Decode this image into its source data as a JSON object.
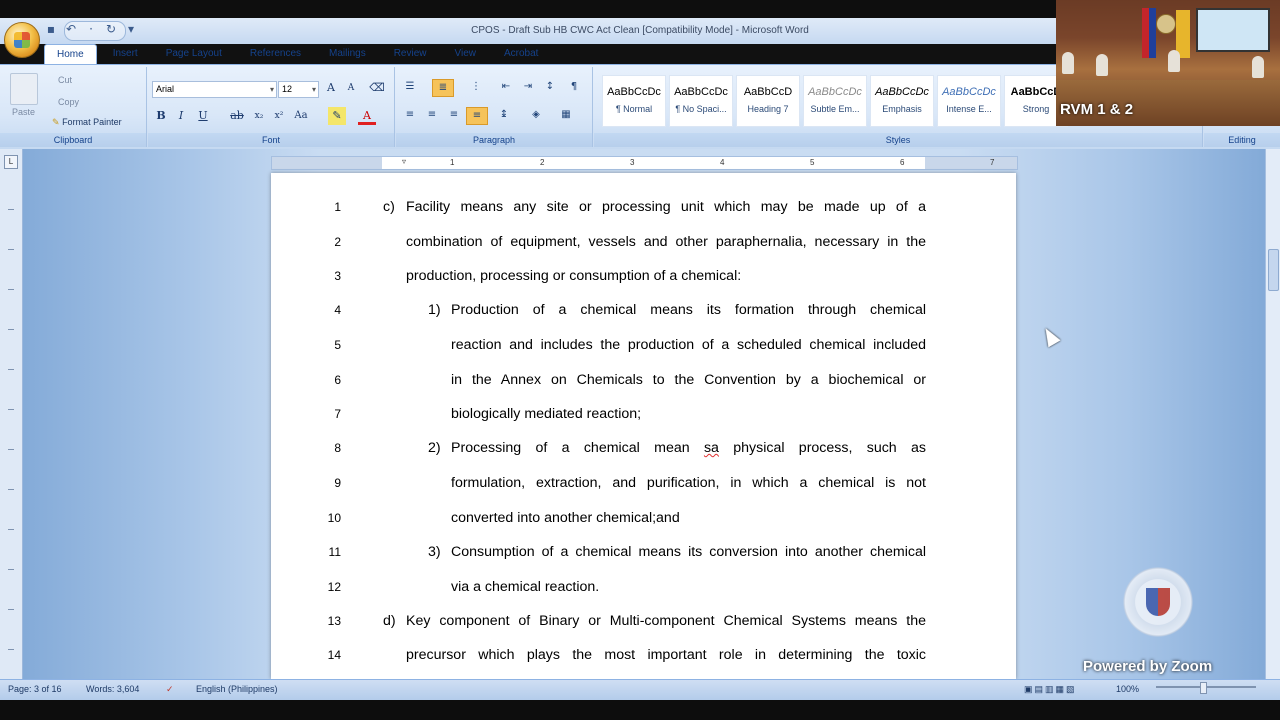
{
  "window": {
    "title": "CPOS - Draft Sub HB CWC Act Clean [Compatibility Mode] - Microsoft Word"
  },
  "ribbon": {
    "tabs": [
      "Home",
      "Insert",
      "Page Layout",
      "References",
      "Mailings",
      "Review",
      "View",
      "Acrobat"
    ],
    "active_tab": "Home",
    "clipboard": {
      "paste": "Paste",
      "cut": "Cut",
      "copy": "Copy",
      "format_painter": "Format Painter",
      "label": "Clipboard"
    },
    "font": {
      "name": "Arial",
      "size": "12",
      "label": "Font"
    },
    "paragraph": {
      "label": "Paragraph"
    },
    "styles": {
      "label": "Styles",
      "items": [
        {
          "sample": "AaBbCcDc",
          "name": "¶ Normal"
        },
        {
          "sample": "AaBbCcDc",
          "name": "¶ No Spaci..."
        },
        {
          "sample": "AaBbCcD",
          "name": "Heading 7"
        },
        {
          "sample": "AaBbCcDc",
          "name": "Subtle Em..."
        },
        {
          "sample": "AaBbCcDc",
          "name": "Emphasis"
        },
        {
          "sample": "AaBbCcDc",
          "name": "Intense E..."
        },
        {
          "sample": "AaBbCcD",
          "name": "Strong"
        }
      ]
    },
    "editing": {
      "label": "Editing"
    }
  },
  "ruler": {
    "numbers": [
      "1",
      "2",
      "3",
      "4",
      "5",
      "6",
      "7"
    ]
  },
  "document": {
    "lines": [
      {
        "n": "1",
        "marker": "c)",
        "text": "Facility means any site or processing unit which may be made up of a"
      },
      {
        "n": "2",
        "text": "combination of equipment, vessels and other paraphernalia, necessary in the"
      },
      {
        "n": "3",
        "text": "production, processing or consumption of a chemical:"
      },
      {
        "n": "4",
        "marker": "1)",
        "text": "Production of a chemical means its formation through chemical"
      },
      {
        "n": "5",
        "text": "reaction and includes the production of a scheduled chemical included"
      },
      {
        "n": "6",
        "text": "in the Annex on Chemicals to the Convention by a biochemical or"
      },
      {
        "n": "7",
        "text": "biologically mediated reaction;"
      },
      {
        "n": "8",
        "marker": "2)",
        "text_a": "Processing of a chemical mean ",
        "text_err": "sa",
        "text_b": " physical process, such as"
      },
      {
        "n": "9",
        "text": "formulation, extraction, and purification, in which a chemical is not"
      },
      {
        "n": "10",
        "text": "converted into another chemical;and"
      },
      {
        "n": "11",
        "marker": "3)",
        "text": "Consumption of a chemical means its conversion into another chemical"
      },
      {
        "n": "12",
        "text": "via a chemical reaction."
      },
      {
        "n": "13",
        "marker": "d)",
        "text": "Key component of Binary or Multi-component Chemical Systems means the"
      },
      {
        "n": "14",
        "text": "precursor which plays the most important role in determining the toxic"
      }
    ]
  },
  "status": {
    "page": "Page: 3 of 16",
    "words": "Words: 3,604",
    "language": "English (Philippines)",
    "zoom": "100%"
  },
  "video": {
    "label": "RVM 1 & 2"
  },
  "overlay": {
    "powered_by": "Powered by Zoom"
  }
}
